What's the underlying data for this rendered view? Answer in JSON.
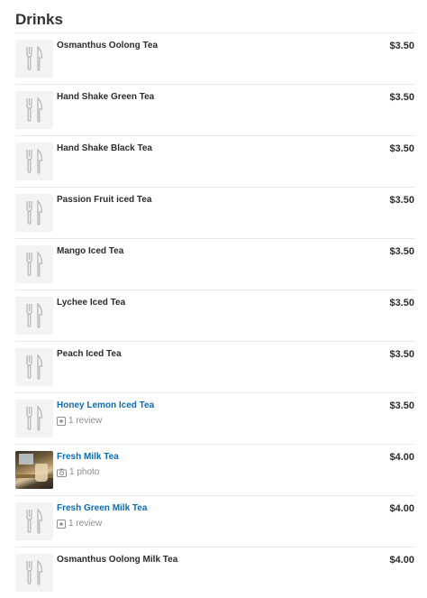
{
  "section": {
    "title": "Drinks"
  },
  "items": [
    {
      "name": "Osmanthus Oolong Tea",
      "price": "$3.50",
      "link": false,
      "meta": "",
      "meta_icon": "",
      "thumb": "utensils-icon"
    },
    {
      "name": "Hand Shake Green Tea",
      "price": "$3.50",
      "link": false,
      "meta": "",
      "meta_icon": "",
      "thumb": "utensils-icon"
    },
    {
      "name": "Hand Shake Black Tea",
      "price": "$3.50",
      "link": false,
      "meta": "",
      "meta_icon": "",
      "thumb": "utensils-icon"
    },
    {
      "name": "Passion Fruit iced Tea",
      "price": "$3.50",
      "link": false,
      "meta": "",
      "meta_icon": "",
      "thumb": "utensils-icon"
    },
    {
      "name": "Mango Iced Tea",
      "price": "$3.50",
      "link": false,
      "meta": "",
      "meta_icon": "",
      "thumb": "utensils-icon"
    },
    {
      "name": "Lychee Iced Tea",
      "price": "$3.50",
      "link": false,
      "meta": "",
      "meta_icon": "",
      "thumb": "utensils-icon"
    },
    {
      "name": "Peach Iced Tea",
      "price": "$3.50",
      "link": false,
      "meta": "",
      "meta_icon": "",
      "thumb": "utensils-icon"
    },
    {
      "name": "Honey Lemon Iced Tea",
      "price": "$3.50",
      "link": true,
      "meta": "1 review",
      "meta_icon": "review-icon",
      "thumb": "utensils-icon"
    },
    {
      "name": "Fresh Milk Tea",
      "price": "$4.00",
      "link": true,
      "meta": "1 photo",
      "meta_icon": "camera-icon",
      "thumb": "photo"
    },
    {
      "name": "Fresh Green Milk Tea",
      "price": "$4.00",
      "link": true,
      "meta": "1 review",
      "meta_icon": "review-icon",
      "thumb": "utensils-icon"
    },
    {
      "name": "Osmanthus Oolong Milk Tea",
      "price": "$4.00",
      "link": false,
      "meta": "",
      "meta_icon": "",
      "thumb": "utensils-icon"
    }
  ],
  "colors": {
    "link": "#0a6bb3",
    "text": "#2b2b2b",
    "meta": "#8c8c8c",
    "divider": "#e8e8e8",
    "thumb_bg": "#f3f3f3"
  }
}
